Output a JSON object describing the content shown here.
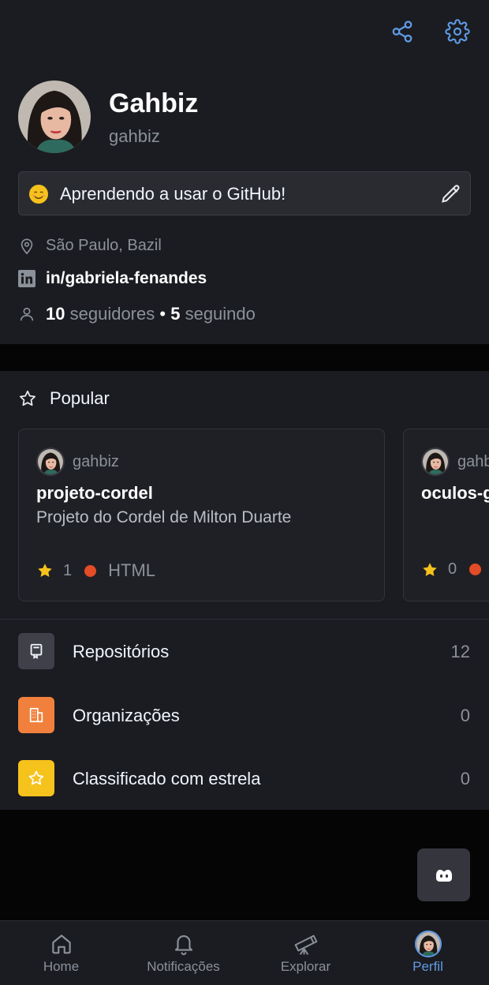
{
  "profile": {
    "display_name": "Gahbiz",
    "login": "gahbiz",
    "status_text": "Aprendendo a usar o GitHub!",
    "location": "São Paulo, Bazil",
    "linkedin": "in/gabriela-fenandes",
    "followers_count": "10",
    "followers_label": "seguidores",
    "separator": "•",
    "following_count": "5",
    "following_label": "seguindo"
  },
  "popular": {
    "title": "Popular",
    "cards": [
      {
        "owner": "gahbiz",
        "repo": "projeto-cordel",
        "description": "Projeto do Cordel de Milton Duarte",
        "stars": "1",
        "language": "HTML",
        "language_color": "#e34c26"
      },
      {
        "owner": "gahbiz",
        "repo": "oculos-g",
        "stars": "0",
        "language_color": "#e34c26"
      }
    ]
  },
  "menu": [
    {
      "label": "Repositórios",
      "count": "12",
      "icon": "repo-icon",
      "color": "#3f4049"
    },
    {
      "label": "Organizações",
      "count": "0",
      "icon": "organization-icon",
      "color": "#f0803c"
    },
    {
      "label": "Classificado com estrela",
      "count": "0",
      "icon": "star-icon",
      "color": "#f6c21c"
    }
  ],
  "tabs": [
    {
      "label": "Home",
      "icon": "home-icon"
    },
    {
      "label": "Notificações",
      "icon": "bell-icon"
    },
    {
      "label": "Explorar",
      "icon": "telescope-icon"
    },
    {
      "label": "Perfil",
      "icon": "avatar",
      "active": true
    }
  ],
  "colors": {
    "accent": "#5f9be6",
    "star": "#f6c21c",
    "background": "#1b1c21"
  }
}
